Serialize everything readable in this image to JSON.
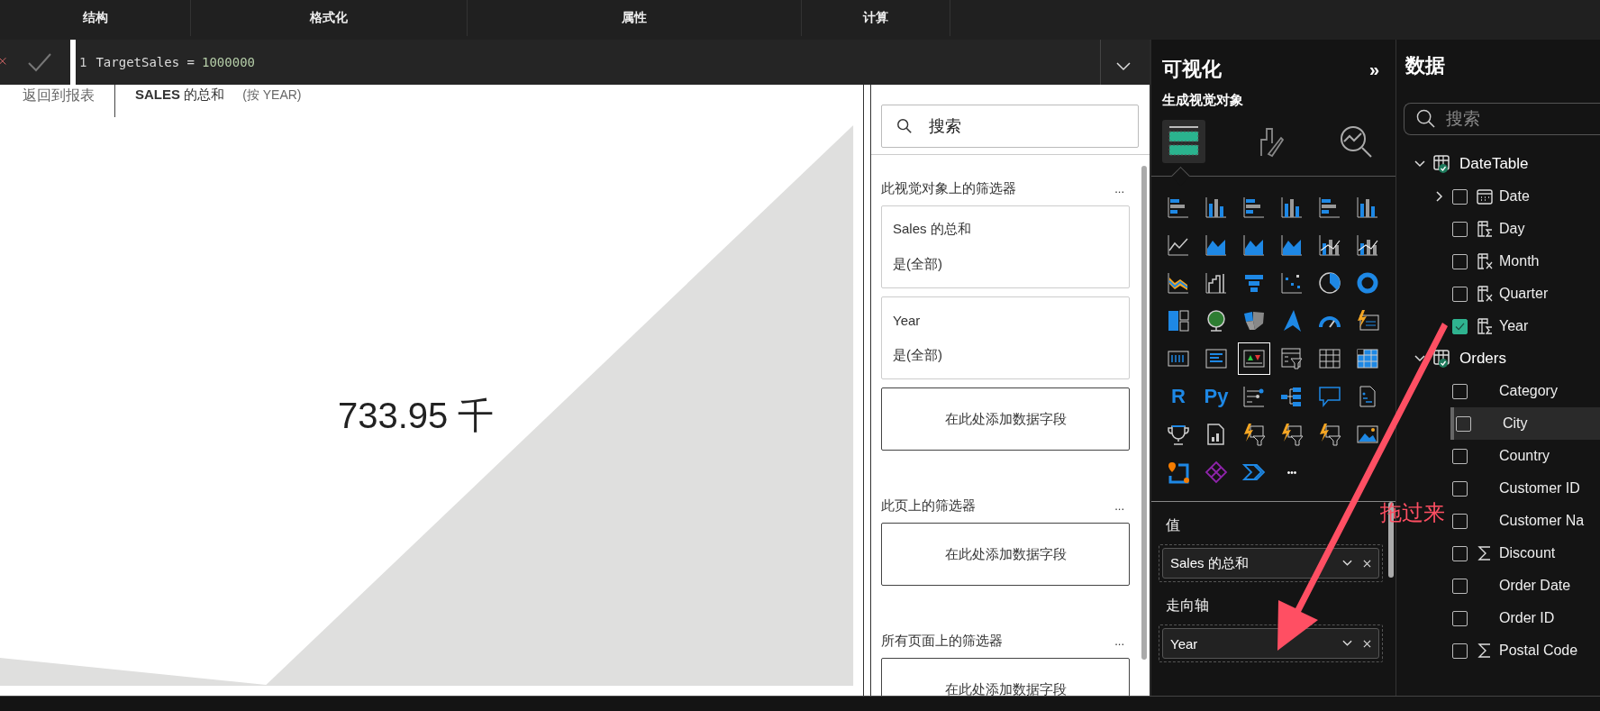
{
  "tabs": [
    {
      "label": "结构"
    },
    {
      "label": "格式化"
    },
    {
      "label": "属性"
    },
    {
      "label": "计算"
    }
  ],
  "formula": {
    "line_number": "1",
    "expression": "TargetSales =",
    "value": "1000000"
  },
  "breadcrumb": {
    "back": "返回到报表",
    "title": "**SALES** 的总和",
    "by": "(按 YEAR)"
  },
  "visual": {
    "value": "733.95 千"
  },
  "filters": {
    "search": {
      "placeholder": "搜索"
    },
    "sections": [
      {
        "title": "此视觉对象上的筛选器",
        "more": "...",
        "cards": [
          {
            "field": "Sales 的总和",
            "state": "是(全部)"
          },
          {
            "field": "Year",
            "state": "是(全部)"
          }
        ],
        "add": "在此处添加数据字段"
      },
      {
        "title": "此页上的筛选器",
        "more": "...",
        "add": "在此处添加数据字段"
      },
      {
        "title": "所有页面上的筛选器",
        "more": "...",
        "add": "在此处添加数据字段"
      }
    ]
  },
  "visualizations": {
    "title": "可视化",
    "collapse": "»",
    "subtitle": "生成视觉对象",
    "pane_tabs": [
      {
        "kind": "build",
        "selected": true
      },
      {
        "kind": "format",
        "selected": false
      },
      {
        "kind": "analytics",
        "selected": false
      }
    ],
    "gallery": [
      {
        "kind": "hbar",
        "selected": false
      },
      {
        "kind": "vbar",
        "selected": false
      },
      {
        "kind": "hbar",
        "selected": false
      },
      {
        "kind": "vbar",
        "selected": false
      },
      {
        "kind": "hbar",
        "selected": false
      },
      {
        "kind": "vbar",
        "selected": false
      },
      {
        "kind": "line",
        "selected": false
      },
      {
        "kind": "area",
        "selected": false
      },
      {
        "kind": "area",
        "selected": false
      },
      {
        "kind": "area",
        "selected": false
      },
      {
        "kind": "combo",
        "selected": false
      },
      {
        "kind": "combo",
        "selected": false
      },
      {
        "kind": "ribbon",
        "selected": false
      },
      {
        "kind": "waterfall",
        "selected": false
      },
      {
        "kind": "funnel",
        "selected": false
      },
      {
        "kind": "scatter",
        "selected": false
      },
      {
        "kind": "pie",
        "selected": false
      },
      {
        "kind": "donut",
        "selected": false
      },
      {
        "kind": "treemap",
        "selected": false
      },
      {
        "kind": "globe",
        "selected": false
      },
      {
        "kind": "map",
        "selected": false
      },
      {
        "kind": "azure",
        "selected": false
      },
      {
        "kind": "gauge",
        "selected": false
      },
      {
        "kind": "kpi",
        "selected": false
      },
      {
        "kind": "card",
        "selected": false
      },
      {
        "kind": "multirow",
        "selected": false
      },
      {
        "kind": "influencer",
        "selected": true
      },
      {
        "kind": "slicer",
        "selected": false
      },
      {
        "kind": "table",
        "selected": false
      },
      {
        "kind": "matrix",
        "selected": false
      },
      {
        "kind": "script",
        "label": "R",
        "selected": false
      },
      {
        "kind": "script",
        "label": "Py",
        "selected": false
      },
      {
        "kind": "decomp",
        "selected": false
      },
      {
        "kind": "tree",
        "selected": false
      },
      {
        "kind": "qna",
        "selected": false
      },
      {
        "kind": "narrative",
        "selected": false
      },
      {
        "kind": "trophy",
        "selected": false
      },
      {
        "kind": "paginated",
        "selected": false
      },
      {
        "kind": "smart",
        "selected": false
      },
      {
        "kind": "smart",
        "selected": false
      },
      {
        "kind": "smart",
        "selected": false
      },
      {
        "kind": "image",
        "selected": false
      },
      {
        "kind": "pin",
        "selected": false
      },
      {
        "kind": "apps",
        "selected": false
      },
      {
        "kind": "automate",
        "selected": false
      },
      {
        "kind": "more",
        "label": "•••",
        "selected": false
      }
    ],
    "wells": [
      {
        "label": "值",
        "field": "Sales 的总和"
      },
      {
        "label": "走向轴",
        "field": "Year"
      }
    ]
  },
  "data": {
    "title": "数据",
    "search": {
      "placeholder": "搜索"
    },
    "tables": [
      {
        "name": "DateTable",
        "expanded": true,
        "fields": [
          {
            "name": "Date",
            "kind": "calendar",
            "checked": false,
            "selected": false
          },
          {
            "name": "Day",
            "kind": "column-calc",
            "checked": false,
            "selected": false
          },
          {
            "name": "Month",
            "kind": "fx",
            "checked": false,
            "selected": false
          },
          {
            "name": "Quarter",
            "kind": "fx",
            "checked": false,
            "selected": false
          },
          {
            "name": "Year",
            "kind": "column-calc",
            "checked": true,
            "selected": false
          }
        ]
      },
      {
        "name": "Orders",
        "expanded": true,
        "fields": [
          {
            "name": "Category",
            "kind": "text",
            "checked": false,
            "selected": false
          },
          {
            "name": "City",
            "kind": "text",
            "checked": false,
            "selected": true
          },
          {
            "name": "Country",
            "kind": "text",
            "checked": false,
            "selected": false
          },
          {
            "name": "Customer ID",
            "kind": "text",
            "checked": false,
            "selected": false
          },
          {
            "name": "Customer Na",
            "kind": "text",
            "checked": false,
            "selected": false
          },
          {
            "name": "Discount",
            "kind": "sum",
            "checked": false,
            "selected": false
          },
          {
            "name": "Order Date",
            "kind": "text",
            "checked": false,
            "selected": false
          },
          {
            "name": "Order ID",
            "kind": "text",
            "checked": false,
            "selected": false
          },
          {
            "name": "Postal Code",
            "kind": "sum",
            "checked": false,
            "selected": false
          }
        ]
      }
    ]
  },
  "annotation": {
    "text": "拖过来"
  }
}
